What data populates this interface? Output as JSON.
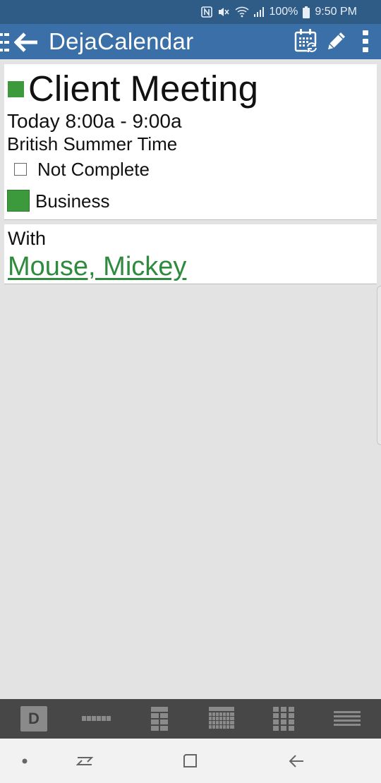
{
  "status_bar": {
    "battery": "100%",
    "time": "9:50 PM",
    "icons": [
      "nfc-icon",
      "mute-icon",
      "wifi-icon",
      "signal-icon",
      "battery-icon"
    ]
  },
  "app_bar": {
    "title": "DejaCalendar",
    "icons": [
      "drawer-icon",
      "back-arrow-icon",
      "calendar-sync-icon",
      "edit-pencil-icon",
      "more-vert-icon"
    ]
  },
  "event": {
    "title": "Client Meeting",
    "time": "Today 8:00a - 9:00a",
    "timezone": "British Summer Time",
    "status": "Not Complete",
    "category": "Business",
    "color": "#3c9a3c"
  },
  "with": {
    "label": "With",
    "attendee": "Mouse, Mickey",
    "link_color": "#2e8b3e"
  },
  "view_bar": {
    "day_letter": "D",
    "views": [
      "day-view",
      "agenda-strip-view",
      "week-view",
      "month-view",
      "year-view",
      "list-view"
    ]
  },
  "colors": {
    "status_bar": "#2f5b87",
    "app_bar": "#3a6fa7",
    "background": "#e3e3e3",
    "view_bar": "#474747"
  }
}
